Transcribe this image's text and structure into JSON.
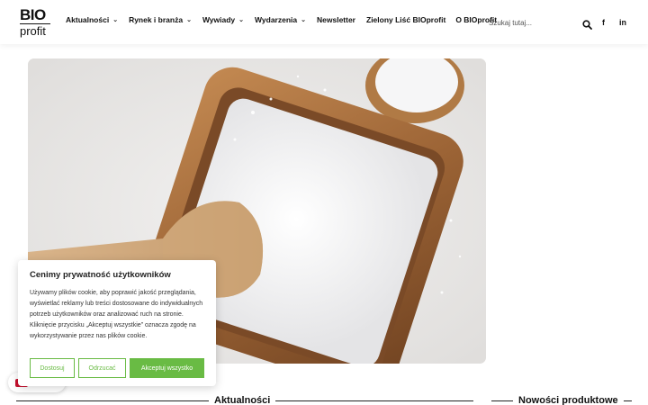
{
  "header": {
    "logo": {
      "line1": "BIO",
      "line2": "profit"
    },
    "nav": [
      {
        "label": "Aktualności",
        "has_dropdown": true
      },
      {
        "label": "Rynek i branża",
        "has_dropdown": true
      },
      {
        "label": "Wywiady",
        "has_dropdown": true
      },
      {
        "label": "Wydarzenia",
        "has_dropdown": true
      },
      {
        "label": "Newsletter",
        "has_dropdown": false
      },
      {
        "label": "Zielony Liść BIOprofit",
        "has_dropdown": false
      },
      {
        "label": "O BIOprofit",
        "has_dropdown": false
      }
    ],
    "search": {
      "placeholder": "Szukaj tutaj...",
      "icon": "search-icon"
    },
    "social": [
      {
        "icon": "facebook-icon",
        "glyph": "f"
      },
      {
        "icon": "linkedin-icon",
        "glyph": "in"
      }
    ]
  },
  "hero": {
    "icon": "salt-bowl-photo"
  },
  "cookie": {
    "title": "Cenimy prywatność użytkowników",
    "text": "Używamy plików cookie, aby poprawić jakość przeglądania, wyświetlać reklamy lub treści dostosowane do indywidualnych potrzeb użytkowników oraz analizować ruch na stronie. Kliknięcie przycisku „Akceptuj wszystkie” oznacza zgodę na wykorzystywanie przez nas plików cookie.",
    "buttons": {
      "customize": "Dostosuj",
      "reject": "Odrzucać",
      "accept": "Akceptuj wszystko"
    }
  },
  "sections": {
    "news": "Aktualności",
    "products": "Nowości produktowe"
  },
  "colors": {
    "accent_green": "#69bb44",
    "text": "#111111"
  }
}
